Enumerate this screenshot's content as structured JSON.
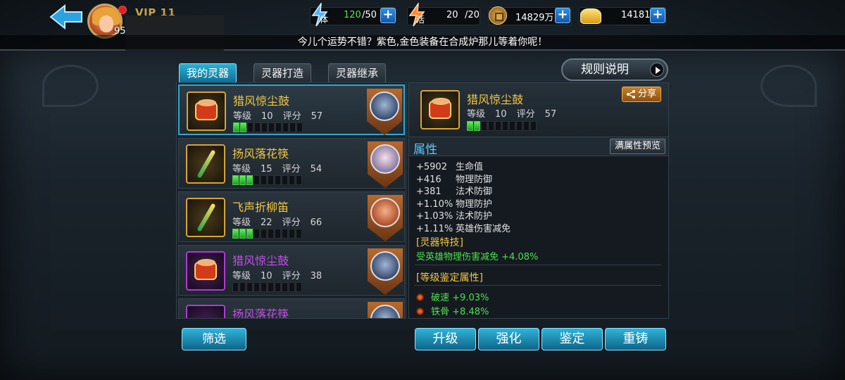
{
  "header": {
    "vip": "VIP 11",
    "level": "95",
    "resources": [
      {
        "name": "stamina",
        "icon": "stamina-icon",
        "value": "120",
        "max": "/50"
      },
      {
        "name": "vitality",
        "icon": "vitality-icon",
        "value": "20",
        "max": "/20"
      },
      {
        "name": "copper",
        "icon": "copper-coin-icon",
        "value": "14829万"
      },
      {
        "name": "gold",
        "icon": "gold-ingot-icon",
        "value": "14181"
      }
    ]
  },
  "marquee": "今儿个运势不错？紫色,金色装备在合成炉那儿等着你呢！",
  "tabs": [
    {
      "label": "我的灵器",
      "active": true
    },
    {
      "label": "灵器打造",
      "active": false
    },
    {
      "label": "灵器继承",
      "active": false
    }
  ],
  "rules_label": "规则说明",
  "list": {
    "level_prefix": "等级",
    "score_prefix": "评分",
    "items": [
      {
        "name": "猎风惊尘鼓",
        "level": "10",
        "score": "57",
        "quality": "gold",
        "bars_on": 2,
        "bars_total": 10
      },
      {
        "name": "扬风落花筷",
        "level": "15",
        "score": "54",
        "quality": "gold",
        "bars_on": 3,
        "bars_total": 10
      },
      {
        "name": "飞声折柳笛",
        "level": "22",
        "score": "66",
        "quality": "gold",
        "bars_on": 3,
        "bars_total": 10
      },
      {
        "name": "猎风惊尘鼓",
        "level": "10",
        "score": "38",
        "quality": "purple",
        "bars_on": 0,
        "bars_total": 10
      },
      {
        "name": "扬风落花筷",
        "quality": "purple"
      }
    ]
  },
  "filter_label": "筛选",
  "detail": {
    "name": "猎风惊尘鼓",
    "level": "10",
    "score": "57",
    "bars_on": 2,
    "bars_total": 10,
    "share_label": "分享",
    "attr_title": "属性",
    "preview_label": "满属性预览",
    "attributes": [
      {
        "value": "+5902",
        "name": "生命值"
      },
      {
        "value": "+416",
        "name": "物理防御"
      },
      {
        "value": "+381",
        "name": "法术防御"
      },
      {
        "value": "+1.10%",
        "name": "物理防护"
      },
      {
        "value": "+1.03%",
        "name": "法术防护"
      },
      {
        "value": "+1.11%",
        "name": "英雄伤害减免"
      }
    ],
    "skill_title": "[灵器特技]",
    "skill_text": "受英雄物理伤害减免 +4.08%",
    "appraise_title": "[等级鉴定属性]",
    "appraise": [
      {
        "name": "破速",
        "value": "+9.03%"
      },
      {
        "name": "铁骨",
        "value": "+8.48%"
      }
    ]
  },
  "actions": [
    "升级",
    "强化",
    "鉴定",
    "重铸"
  ],
  "colors": {
    "gold_name": "#f2c744",
    "purple_name": "#c24fe8",
    "green_text": "#4ee04e",
    "accent_blue": "#5cc8ff"
  }
}
